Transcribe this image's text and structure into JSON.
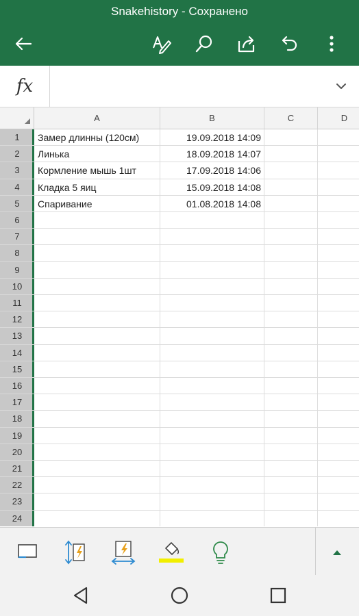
{
  "app": {
    "title": "Snakehistory - Сохранено"
  },
  "toolbar": {
    "icons": [
      "back-arrow-icon",
      "edit-pen-icon",
      "search-icon",
      "share-icon",
      "undo-icon",
      "more-vert-icon"
    ],
    "accent": "#217346"
  },
  "formula_bar": {
    "fx_label": "fx",
    "value": ""
  },
  "sheet": {
    "columns": [
      "A",
      "B",
      "C",
      "D"
    ],
    "rows": [
      {
        "n": "1",
        "a": "Замер длинны (120см)",
        "b": "19.09.2018 14:09"
      },
      {
        "n": "2",
        "a": "Линька",
        "b": "18.09.2018 14:07"
      },
      {
        "n": "3",
        "a": "Кормление мышь 1шт",
        "b": "17.09.2018 14:06"
      },
      {
        "n": "4",
        "a": "Кладка 5 яиц",
        "b": "15.09.2018 14:08"
      },
      {
        "n": "5",
        "a": "Спаривание",
        "b": "01.08.2018 14:08"
      },
      {
        "n": "6",
        "a": "",
        "b": ""
      },
      {
        "n": "7",
        "a": "",
        "b": ""
      },
      {
        "n": "8",
        "a": "",
        "b": ""
      },
      {
        "n": "9",
        "a": "",
        "b": ""
      },
      {
        "n": "10",
        "a": "",
        "b": ""
      },
      {
        "n": "11",
        "a": "",
        "b": ""
      },
      {
        "n": "12",
        "a": "",
        "b": ""
      },
      {
        "n": "13",
        "a": "",
        "b": ""
      },
      {
        "n": "14",
        "a": "",
        "b": ""
      },
      {
        "n": "15",
        "a": "",
        "b": ""
      },
      {
        "n": "16",
        "a": "",
        "b": ""
      },
      {
        "n": "17",
        "a": "",
        "b": ""
      },
      {
        "n": "18",
        "a": "",
        "b": ""
      },
      {
        "n": "19",
        "a": "",
        "b": ""
      },
      {
        "n": "20",
        "a": "",
        "b": ""
      },
      {
        "n": "21",
        "a": "",
        "b": ""
      },
      {
        "n": "22",
        "a": "",
        "b": ""
      },
      {
        "n": "23",
        "a": "",
        "b": ""
      },
      {
        "n": "24",
        "a": "",
        "b": ""
      }
    ]
  },
  "bottom_toolbar": {
    "icons": [
      "display-icon",
      "row-height-icon",
      "column-width-icon",
      "fill-color-icon",
      "ideas-lightbulb-icon",
      "expand-up-icon"
    ],
    "fill_color": "#f2ef00"
  },
  "navigation": {
    "icons": [
      "nav-back-icon",
      "nav-home-icon",
      "nav-recents-icon"
    ]
  }
}
